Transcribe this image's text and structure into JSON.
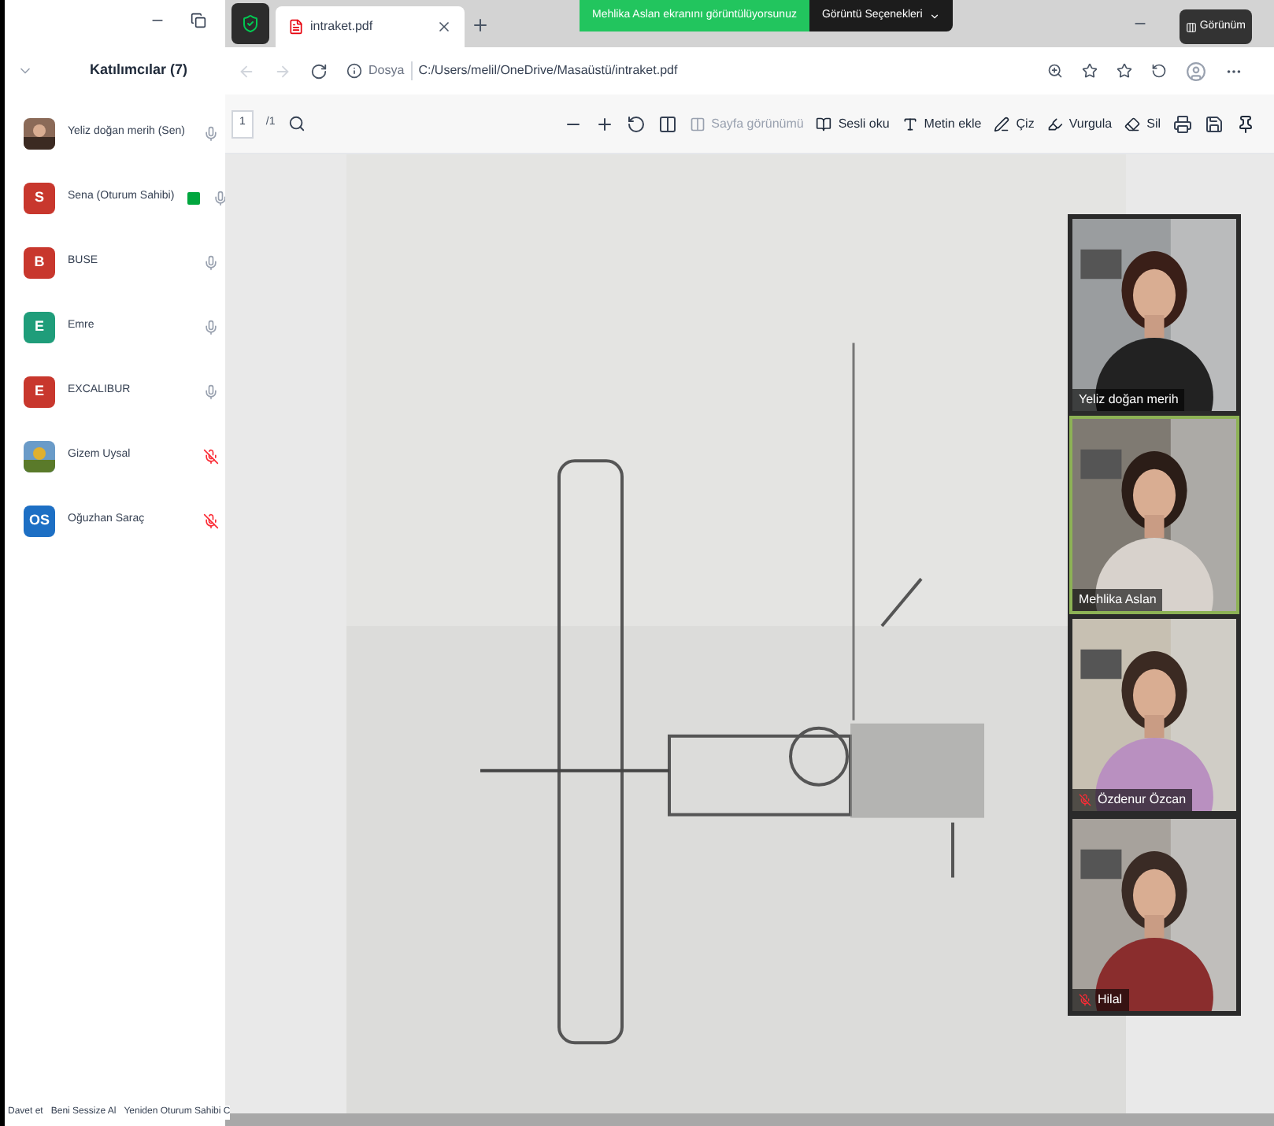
{
  "participants_panel": {
    "title": "Katılımcılar (7)",
    "participants": [
      {
        "name": "Yeliz doğan merih (Sen)",
        "muted": false,
        "video_badge": false
      },
      {
        "name": "Sena (Oturum Sahibi)",
        "avatar": {
          "kind": "initials",
          "initials": "S",
          "color": "#c8372d"
        },
        "muted": false,
        "video_badge": true
      },
      {
        "name": "BUSE",
        "avatar": {
          "kind": "initials",
          "initials": "B",
          "color": "#c8372d"
        },
        "muted": false,
        "video_badge": false
      },
      {
        "name": "Emre",
        "avatar": {
          "kind": "initials",
          "initials": "E",
          "color": "#1f9d7a"
        },
        "muted": false,
        "video_badge": false
      },
      {
        "name": "EXCALIBUR",
        "avatar": {
          "kind": "initials",
          "initials": "E",
          "color": "#c8372d"
        },
        "muted": false,
        "video_badge": false
      },
      {
        "name": "Gizem Uysal",
        "muted": true,
        "video_badge": false
      },
      {
        "name": "Oğuzhan Saraç",
        "avatar": {
          "kind": "initials",
          "initials": "OS",
          "color": "#1d6fc4"
        },
        "muted": true,
        "video_badge": false
      }
    ],
    "footer_buttons": [
      "Davet et",
      "Beni Sessize Al",
      "Yeniden Oturum Sahibi C"
    ]
  },
  "share_banner": {
    "text": "Mehlika Aslan ekranını görüntülüyorsunuz",
    "options_button": "Görüntü Seçenekleri",
    "view_button": "Görünüm"
  },
  "browser": {
    "tab": {
      "title": "intraket.pdf"
    },
    "address": {
      "label": "Dosya",
      "url": "C:/Users/melil/OneDrive/Masaüstü/intraket.pdf"
    }
  },
  "pdf_toolbar": {
    "page": "1",
    "page_count": "/1",
    "tools": [
      {
        "label": "Sayfa görünümü",
        "disabled": true
      },
      {
        "label": "Sesli oku",
        "disabled": false
      },
      {
        "label": "Metin ekle",
        "disabled": false
      },
      {
        "label": "Çiz",
        "disabled": false
      },
      {
        "label": "Vurgula",
        "disabled": false
      },
      {
        "label": "Sil",
        "disabled": false
      }
    ]
  },
  "video_tiles": [
    {
      "name": "Yeliz doğan merih",
      "muted": false,
      "speaking": false
    },
    {
      "name": "Mehlika Aslan",
      "muted": false,
      "speaking": true
    },
    {
      "name": "Özdenur Özcan",
      "muted": true,
      "speaking": false
    },
    {
      "name": "Hilal",
      "muted": true,
      "speaking": false
    }
  ]
}
